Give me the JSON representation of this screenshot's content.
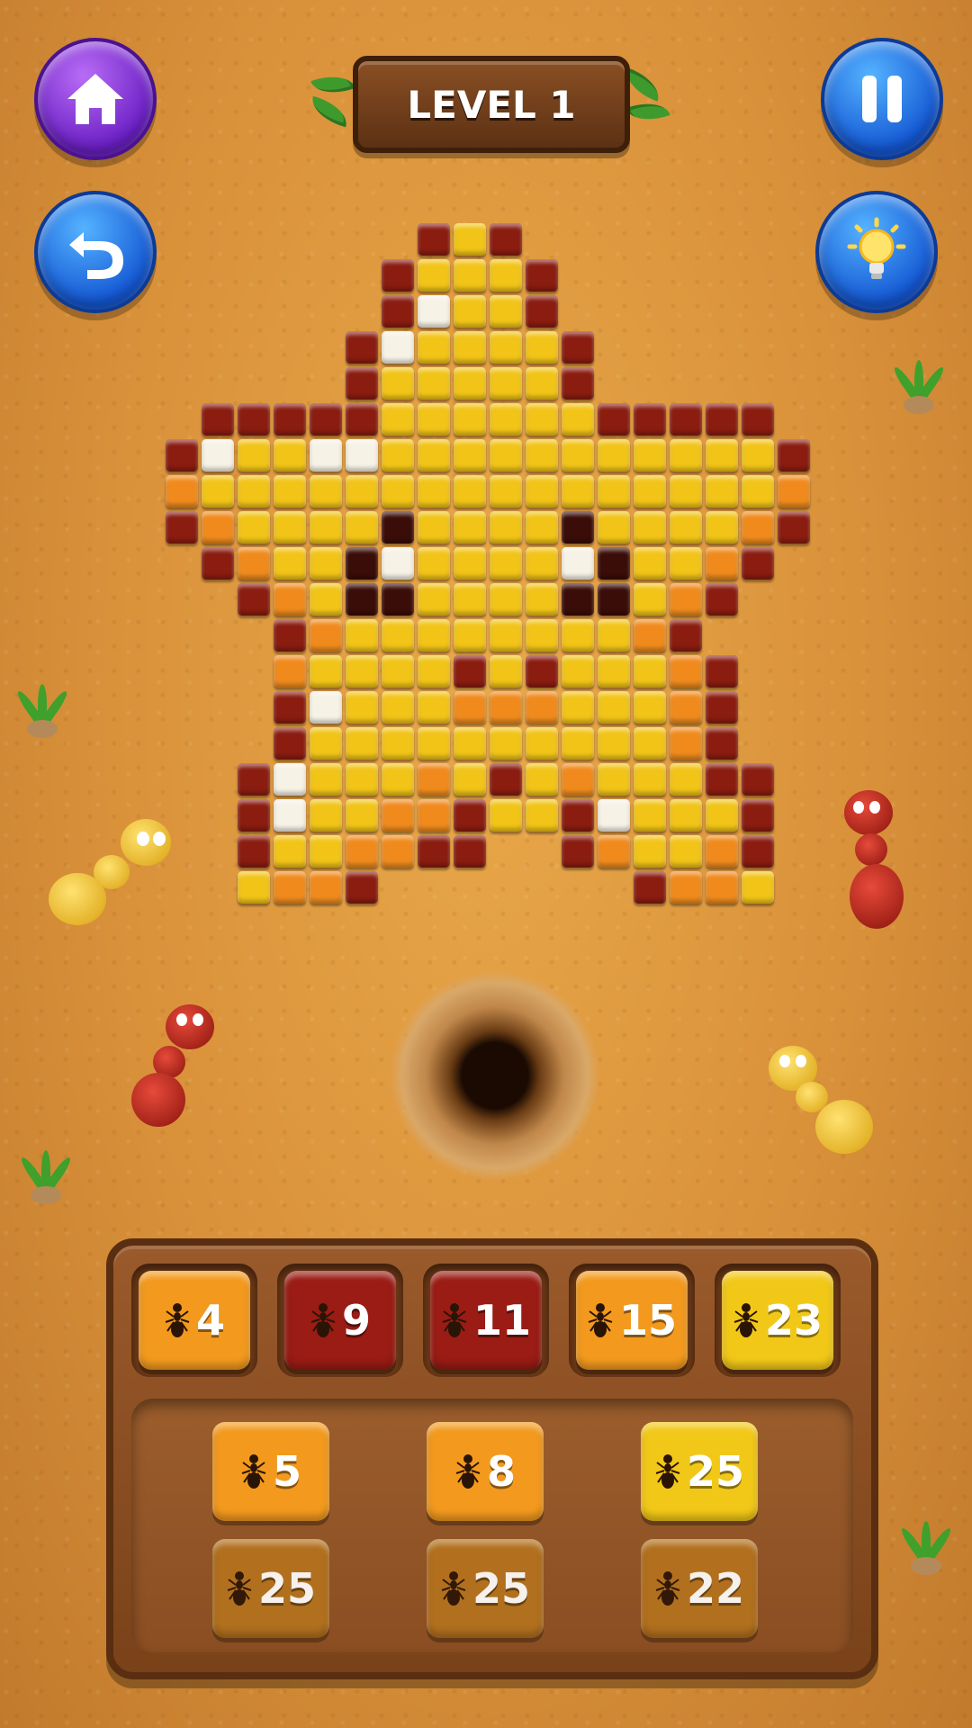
{
  "header": {
    "level_label": "LEVEL 1"
  },
  "buttons": {
    "home": {
      "icon": "home-icon"
    },
    "pause": {
      "icon": "pause-icon"
    },
    "undo": {
      "icon": "undo-icon"
    },
    "hint": {
      "icon": "lightbulb-icon"
    }
  },
  "palette": {
    "Y": "#f2c418",
    "O": "#f08a1c",
    "D": "#8a1c10",
    "W": "#f6f2e6",
    "K": "#3a0d08"
  },
  "picture_rows": [
    "........DYD........",
    ".......DYYYD.......",
    ".......DWYYD.......",
    "......DWYYYYD......",
    "......DYYYYYD......",
    "..DDDDDYYYYYYDDDDD.",
    ".DWYYWWYYYYYYYYYYYD",
    ".OYYYYYYYYYYYYYYYYO",
    ".DOYYYYKYYYYKYYYYOD",
    "..DOYYKWYYYYWKYYOD.",
    "...DOYKKYYYYKKYOD..",
    "....DOYYYYYYYYOD...",
    "....OYYYYDYDYYYOD..",
    "....DWYYYOOOYYYOD..",
    "....DYYYYYYYYYYOD..",
    "...DWYYYOYDYOYYYDD.",
    "...DWYYOODYYDWYYYD.",
    "...DYYOODD..DOYYOD.",
    "...YOOD.......DOOY."
  ],
  "queue": [
    {
      "count": "4",
      "color": "orange"
    },
    {
      "count": "9",
      "color": "red"
    },
    {
      "count": "11",
      "color": "red"
    },
    {
      "count": "15",
      "color": "orange"
    },
    {
      "count": "23",
      "color": "yellow"
    }
  ],
  "storage": [
    {
      "count": "5",
      "color": "orange"
    },
    {
      "count": "8",
      "color": "orange"
    },
    {
      "count": "25",
      "color": "yellow"
    },
    {
      "count": "25",
      "color": "locked"
    },
    {
      "count": "25",
      "color": "locked"
    },
    {
      "count": "22",
      "color": "locked"
    }
  ],
  "box_colors": {
    "orange": "#f39a1e",
    "red": "#9a1c14",
    "yellow": "#f2c818",
    "locked": "#b5731e"
  }
}
